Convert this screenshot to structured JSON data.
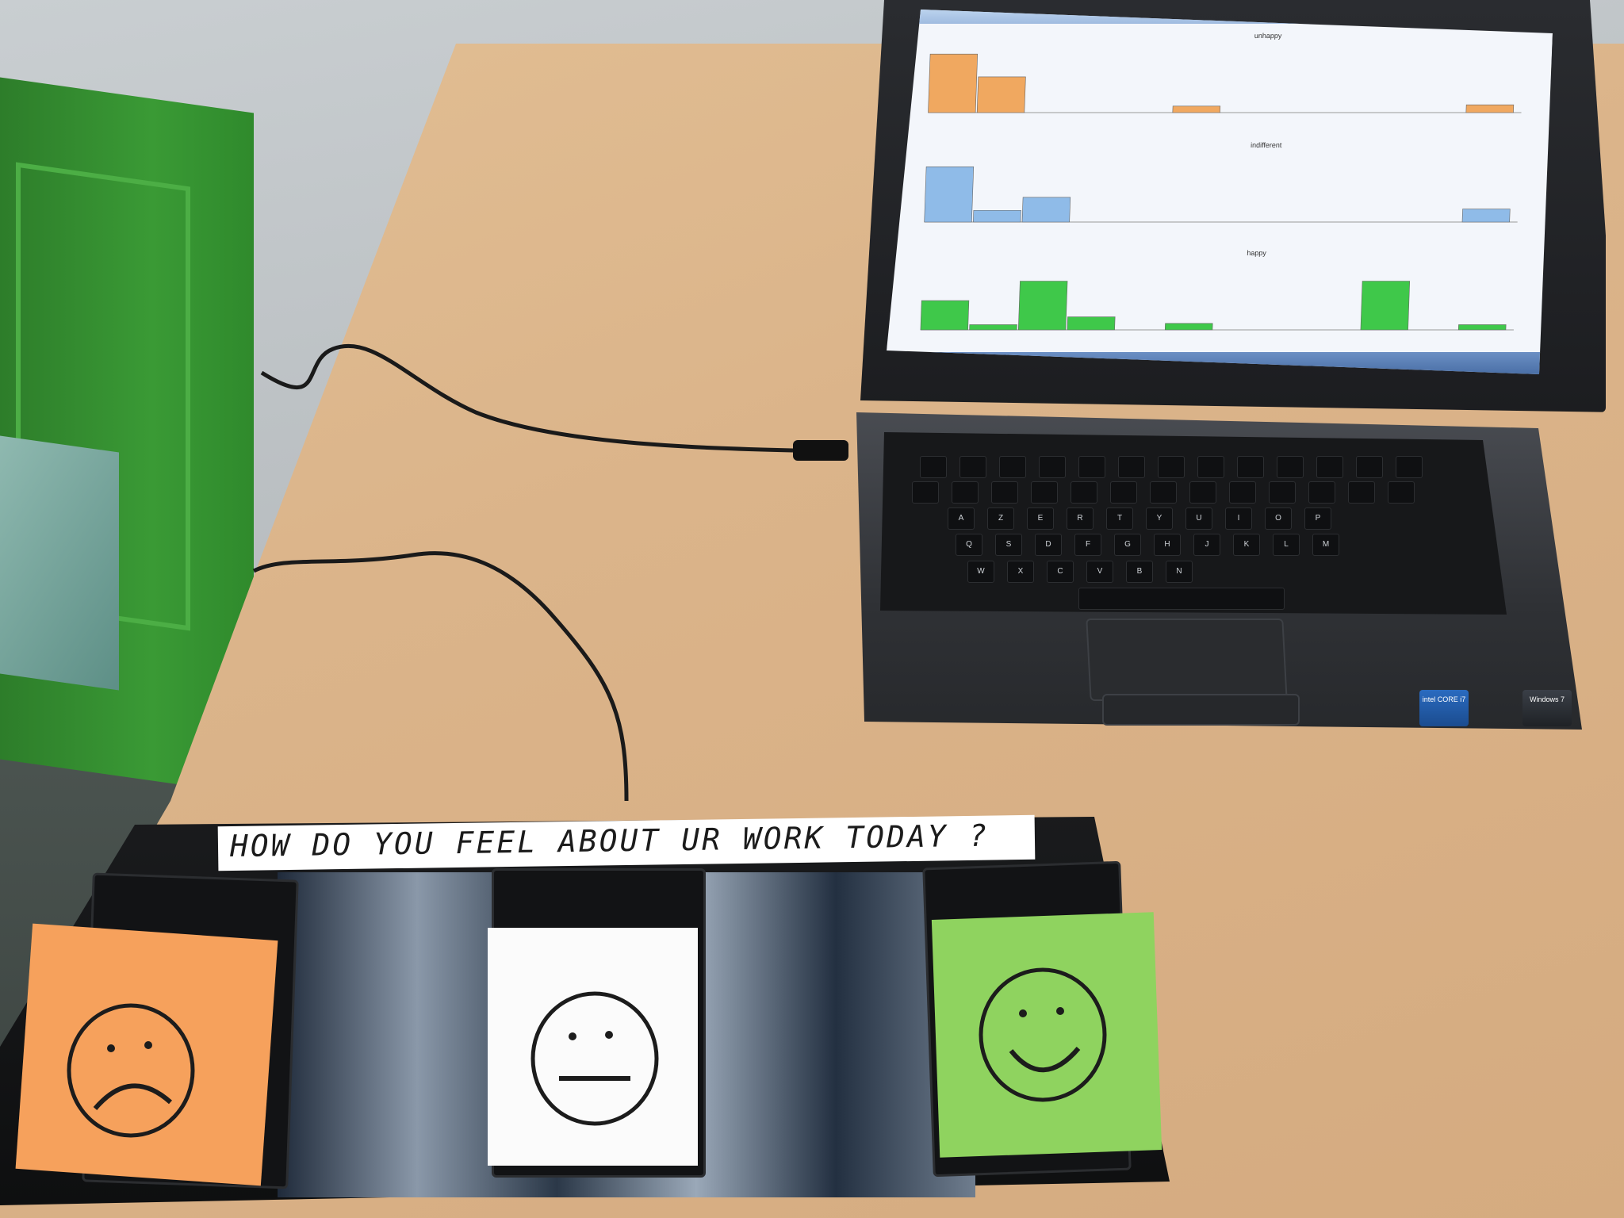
{
  "scene": {
    "question": "HOW DO YOU FEEL ABOUT UR WORK TODAY ?"
  },
  "laptop": {
    "charts": [
      {
        "title": "unhappy",
        "color": "#f0a860"
      },
      {
        "title": "indifferent",
        "color": "#8fbbe8"
      },
      {
        "title": "happy",
        "color": "#3fc84a"
      }
    ],
    "keyboard_row_labels": [
      "A",
      "Z",
      "E",
      "R",
      "T",
      "Y",
      "U",
      "I",
      "O",
      "P"
    ],
    "keyboard_row2_labels": [
      "Q",
      "S",
      "D",
      "F",
      "G",
      "H",
      "J",
      "K",
      "L",
      "M"
    ],
    "keyboard_row3_labels": [
      "W",
      "X",
      "C",
      "V",
      "B",
      "N"
    ],
    "stickers": {
      "intel": "intel CORE i7",
      "windows": "Windows 7"
    }
  },
  "pedals": [
    {
      "mood": "unhappy",
      "note_color": "#f6a15c",
      "expression": "frown"
    },
    {
      "mood": "indifferent",
      "note_color": "#fbfbfb",
      "expression": "neutral"
    },
    {
      "mood": "happy",
      "note_color": "#8fd35f",
      "expression": "smile"
    }
  ]
}
